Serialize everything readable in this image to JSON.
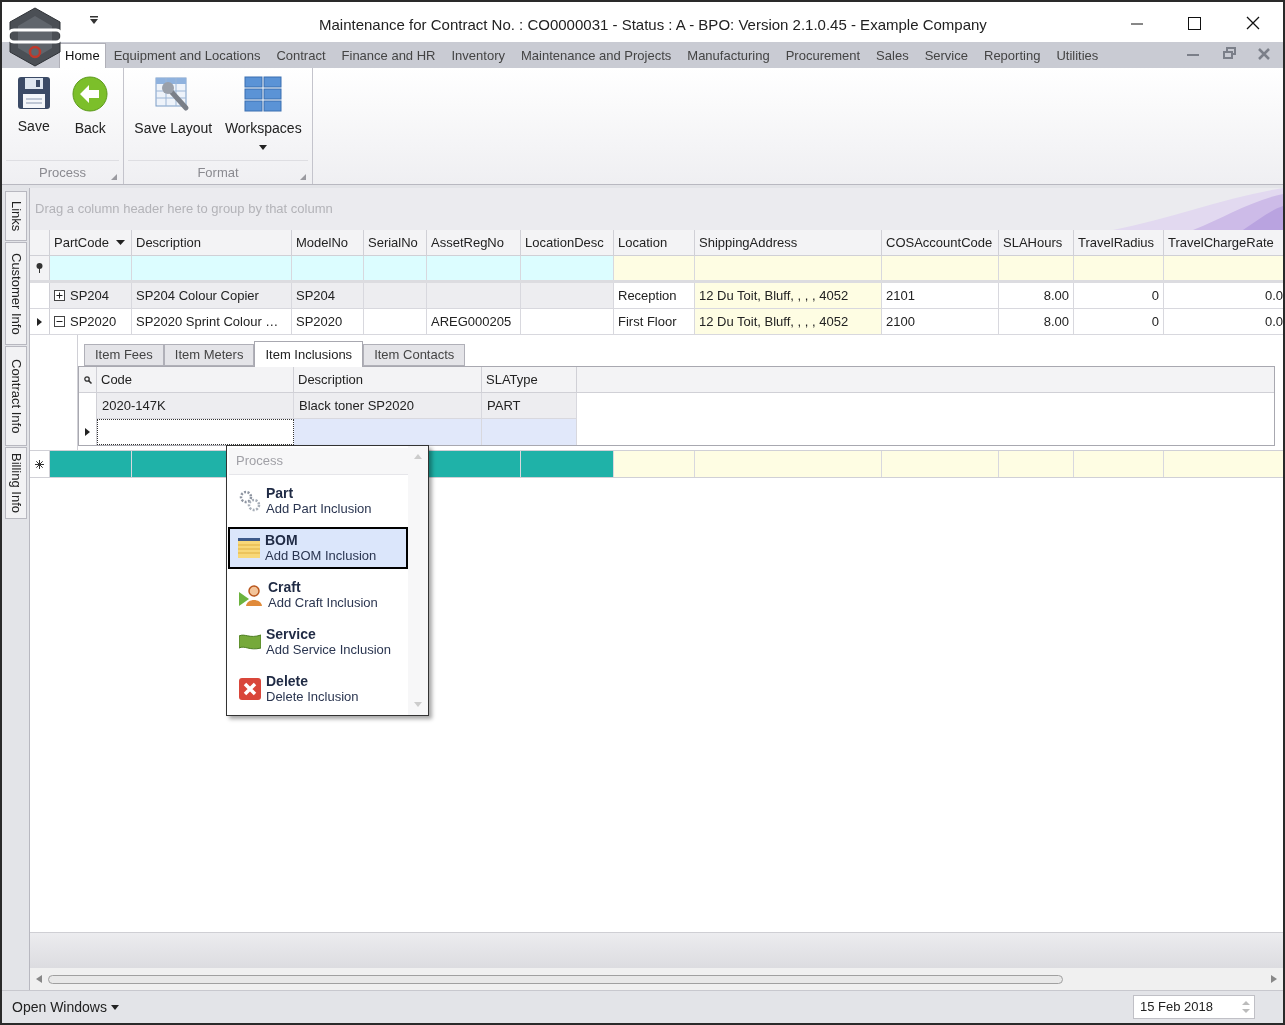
{
  "window": {
    "title": "Maintenance for Contract No. : CO0000031 - Status : A - BPO: Version 2.1.0.45 - Example Company"
  },
  "ribbon": {
    "tabs": [
      {
        "label": "Home",
        "selected": true
      },
      {
        "label": "Equipment and Locations",
        "selected": false
      },
      {
        "label": "Contract",
        "selected": false
      },
      {
        "label": "Finance and HR",
        "selected": false
      },
      {
        "label": "Inventory",
        "selected": false
      },
      {
        "label": "Maintenance and Projects",
        "selected": false
      },
      {
        "label": "Manufacturing",
        "selected": false
      },
      {
        "label": "Procurement",
        "selected": false
      },
      {
        "label": "Sales",
        "selected": false
      },
      {
        "label": "Service",
        "selected": false
      },
      {
        "label": "Reporting",
        "selected": false
      },
      {
        "label": "Utilities",
        "selected": false
      }
    ],
    "groups": [
      {
        "caption": "Process",
        "buttons": [
          {
            "label": "Save",
            "kind": "save",
            "dropdown": false
          },
          {
            "label": "Back",
            "kind": "back",
            "dropdown": false
          }
        ]
      },
      {
        "caption": "Format",
        "buttons": [
          {
            "label": "Save Layout",
            "kind": "layout",
            "dropdown": false
          },
          {
            "label": "Workspaces",
            "kind": "workspaces",
            "dropdown": true
          }
        ]
      }
    ]
  },
  "side_tabs": [
    "Links",
    "Customer Info",
    "Contract Info",
    "Billing Info"
  ],
  "grid": {
    "group_panel_hint": "Drag a column header here to group by that column",
    "columns": [
      {
        "label": "PartCode",
        "sorted": true,
        "kind": "key"
      },
      {
        "label": "Description",
        "sorted": false,
        "kind": "key"
      },
      {
        "label": "ModelNo",
        "sorted": false,
        "kind": "key"
      },
      {
        "label": "SerialNo",
        "sorted": false,
        "kind": "key"
      },
      {
        "label": "AssetRegNo",
        "sorted": false,
        "kind": "key"
      },
      {
        "label": "LocationDesc",
        "sorted": false,
        "kind": "key"
      },
      {
        "label": "Location",
        "sorted": false,
        "kind": "info"
      },
      {
        "label": "ShippingAddress",
        "sorted": false,
        "kind": "info"
      },
      {
        "label": "COSAccountCode",
        "sorted": false,
        "kind": "info"
      },
      {
        "label": "SLAHours",
        "sorted": false,
        "kind": "info"
      },
      {
        "label": "TravelRadius",
        "sorted": false,
        "kind": "info"
      },
      {
        "label": "TravelChargeRate",
        "sorted": false,
        "kind": "info"
      }
    ],
    "rows": [
      {
        "expanded": false,
        "current": false,
        "cells": [
          "SP204",
          "SP204 Colour Copier",
          "SP204",
          "",
          "",
          "",
          "Reception",
          "12 Du Toit, Bluff, , , , 4052",
          "2101",
          "8.00",
          "0",
          "0.0"
        ]
      },
      {
        "expanded": true,
        "current": true,
        "cells": [
          "SP2020",
          "SP2020 Sprint Colour …",
          "SP2020",
          "",
          "AREG000205",
          "",
          "First Floor",
          "12 Du Toit, Bluff, , , , 4052",
          "2100",
          "8.00",
          "0",
          "0.0"
        ]
      }
    ],
    "detail": {
      "tabs": [
        {
          "label": "Item Fees",
          "selected": false
        },
        {
          "label": "Item Meters",
          "selected": false
        },
        {
          "label": "Item Inclusions",
          "selected": true
        },
        {
          "label": "Item Contacts",
          "selected": false
        }
      ],
      "columns": [
        "Code",
        "Description",
        "SLAType"
      ],
      "rows": [
        {
          "cells": [
            "2020-147K",
            "Black toner SP2020",
            "PART"
          ]
        }
      ],
      "new_row_current": true
    }
  },
  "context_menu": {
    "header": "Process",
    "items": [
      {
        "kind": "part",
        "title": "Part",
        "subtitle": "Add Part Inclusion",
        "selected": false
      },
      {
        "kind": "bom",
        "title": "BOM",
        "subtitle": "Add BOM Inclusion",
        "selected": true
      },
      {
        "kind": "craft",
        "title": "Craft",
        "subtitle": "Add Craft Inclusion",
        "selected": false
      },
      {
        "kind": "service",
        "title": "Service",
        "subtitle": "Add Service Inclusion",
        "selected": false
      },
      {
        "kind": "delete",
        "title": "Delete",
        "subtitle": "Delete Inclusion",
        "selected": false
      }
    ]
  },
  "status_bar": {
    "open_windows": "Open Windows",
    "date": "15 Feb 2018"
  }
}
